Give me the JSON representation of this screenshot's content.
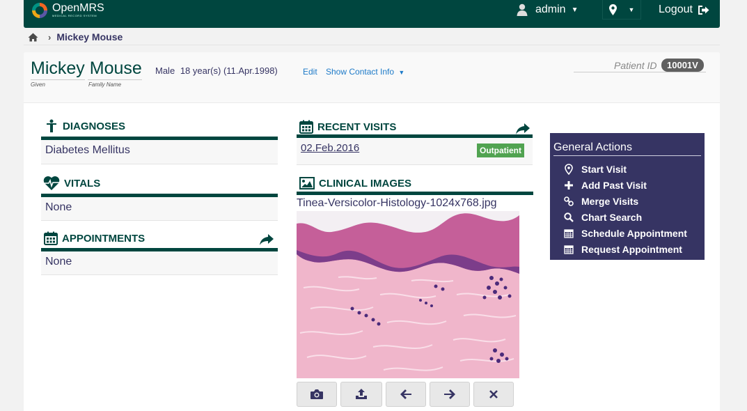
{
  "app": {
    "title": "OpenMRS",
    "subtitle": "MEDICAL RECORD SYSTEM",
    "user": "admin",
    "logout_label": "Logout"
  },
  "breadcrumb": {
    "current": "Mickey Mouse"
  },
  "patient": {
    "given": "Mickey",
    "family": "Mouse",
    "given_caption": "Given",
    "family_caption": "Family Name",
    "gender": "Male",
    "age_birth": "18 year(s) (11.Apr.1998)",
    "edit_label": "Edit",
    "contact_label": "Show Contact Info",
    "id_label": "Patient ID",
    "id_value": "10001V"
  },
  "sections": {
    "diagnoses": {
      "title": "DIAGNOSES",
      "value": "Diabetes Mellitus"
    },
    "vitals": {
      "title": "VITALS",
      "value": "None"
    },
    "appointments": {
      "title": "APPOINTMENTS",
      "value": "None"
    },
    "recent_visits": {
      "title": "RECENT VISITS",
      "visits": [
        {
          "date": "02.Feb.2016",
          "type": "Outpatient"
        }
      ]
    },
    "clinical_images": {
      "title": "CLINICAL IMAGES",
      "file_name": "Tinea-Versicolor-Histology-1024x768.jpg"
    }
  },
  "general_actions": {
    "title": "General Actions",
    "items": [
      {
        "label": "Start Visit",
        "icon": "map-marker-icon"
      },
      {
        "label": "Add Past Visit",
        "icon": "plus-icon"
      },
      {
        "label": "Merge Visits",
        "icon": "link-icon"
      },
      {
        "label": "Chart Search",
        "icon": "search-icon"
      },
      {
        "label": "Schedule Appointment",
        "icon": "calendar-icon"
      },
      {
        "label": "Request Appointment",
        "icon": "calendar-icon"
      }
    ]
  },
  "colors": {
    "header_green": "#00463f",
    "actions_purple": "#363463",
    "outpatient_green": "#51a351",
    "link_blue": "#1d7ac8"
  }
}
